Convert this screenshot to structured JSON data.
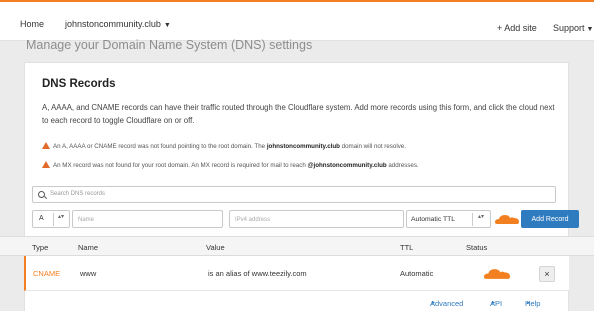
{
  "topbar": {
    "home": "Home",
    "domain": "johnstoncommunity.club",
    "add_site": "+ Add site",
    "support": "Support"
  },
  "page_heading": "Manage your Domain Name System (DNS) settings",
  "dns_card": {
    "title": "DNS Records",
    "description": "A, AAAA, and CNAME records can have their traffic routed through the Cloudflare system. Add more records using this form, and click the cloud next to each record to toggle Cloudflare on or off.",
    "warnings": [
      {
        "before": "An A, AAAA or CNAME record was not found pointing to the root domain. The ",
        "domain": "johnstoncommunity.club",
        "after": " domain will not resolve."
      },
      {
        "before": "An MX record was not found for your root domain. An MX record is required for mail to reach ",
        "domain": "@johnstoncommunity.club",
        "after": " addresses."
      }
    ],
    "search_placeholder": "Search DNS records",
    "form": {
      "type_value": "A",
      "name_placeholder": "Name",
      "ip_placeholder": "IPv4 address",
      "ttl_value": "Automatic TTL",
      "add_button": "Add Record"
    }
  },
  "table": {
    "headers": [
      "Type",
      "Name",
      "Value",
      "TTL",
      "Status"
    ],
    "rows": [
      {
        "type": "CNAME",
        "name": "www",
        "value": "is an alias of www.teezily.com",
        "ttl": "Automatic",
        "delete": "×"
      }
    ]
  },
  "footer_links": {
    "advanced": "Advanced",
    "api": "API",
    "help": "Help"
  },
  "glyphs": {
    "caret": "▼",
    "stepper": "▴▾",
    "link_arrow": "▸"
  },
  "colors": {
    "accent_orange": "#f38020",
    "button_blue": "#2f7bbf",
    "warning_orange": "#e3692b"
  },
  "icons": [
    "search-icon",
    "warning-icon",
    "cloud-proxy-icon",
    "close-icon",
    "chevron-down-icon",
    "stepper-icon"
  ]
}
